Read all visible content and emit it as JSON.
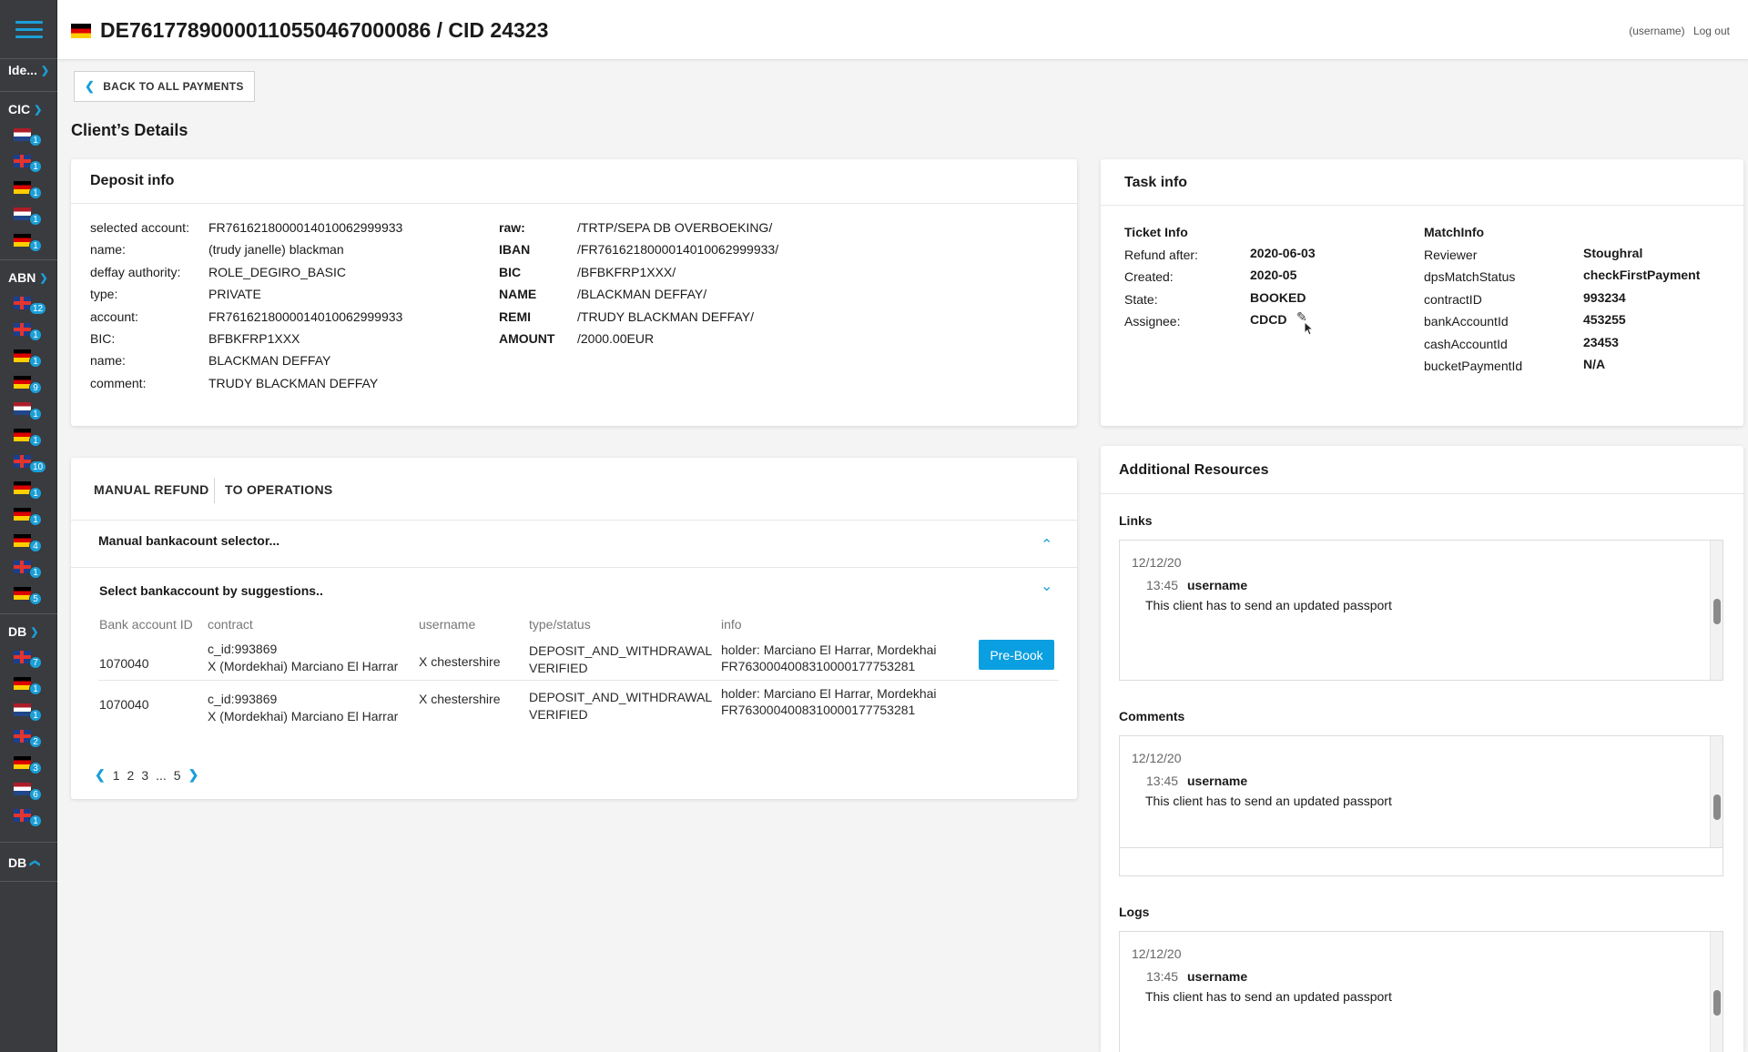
{
  "header": {
    "title": "DE76177890000110550467000086 / CID 24323",
    "username": "(username)",
    "logout_label": "Log out"
  },
  "sidebar": {
    "groups": [
      {
        "label": "Ide...",
        "items": []
      },
      {
        "label": "CIC",
        "items": [
          {
            "flag": "nl",
            "badge": "1"
          },
          {
            "flag": "uk",
            "badge": "1"
          },
          {
            "flag": "de",
            "badge": "1"
          },
          {
            "flag": "nl",
            "badge": "1"
          },
          {
            "flag": "de",
            "badge": "1"
          }
        ]
      },
      {
        "label": "ABN",
        "items": [
          {
            "flag": "uk",
            "badge": "12"
          },
          {
            "flag": "uk",
            "badge": "1"
          },
          {
            "flag": "de",
            "badge": "1"
          },
          {
            "flag": "de",
            "badge": "9"
          },
          {
            "flag": "nl",
            "badge": "1"
          },
          {
            "flag": "de",
            "badge": "1"
          },
          {
            "flag": "uk",
            "badge": "10"
          },
          {
            "flag": "de",
            "badge": "1"
          },
          {
            "flag": "de",
            "badge": "1"
          },
          {
            "flag": "de",
            "badge": "4"
          },
          {
            "flag": "uk",
            "badge": "1"
          },
          {
            "flag": "de",
            "badge": "5"
          }
        ]
      },
      {
        "label": "DB",
        "items": [
          {
            "flag": "uk",
            "badge": "7"
          },
          {
            "flag": "de",
            "badge": "1"
          },
          {
            "flag": "nl",
            "badge": "1"
          },
          {
            "flag": "uk",
            "badge": "2"
          },
          {
            "flag": "de",
            "badge": "3"
          },
          {
            "flag": "nl",
            "badge": "6"
          },
          {
            "flag": "uk",
            "badge": "1"
          }
        ]
      },
      {
        "label": "DB",
        "items": []
      }
    ]
  },
  "back_label": "BACK TO ALL PAYMENTS",
  "section_title": "Client’s Details",
  "deposit": {
    "title": "Deposit info",
    "left": [
      {
        "k": "selected account:",
        "v": "FR7616218000014010062999933"
      },
      {
        "k": "name:",
        "v": "(trudy janelle) blackman"
      },
      {
        "k": "deffay authority:",
        "v": "ROLE_DEGIRO_BASIC"
      },
      {
        "k": "type:",
        "v": "PRIVATE"
      },
      {
        "k": "account:",
        "v": "FR7616218000014010062999933"
      },
      {
        "k": "BIC:",
        "v": "BFBKFRP1XXX"
      },
      {
        "k": "name:",
        "v": "BLACKMAN DEFFAY"
      },
      {
        "k": "comment:",
        "v": "TRUDY BLACKMAN DEFFAY"
      }
    ],
    "right": [
      {
        "k": "raw:",
        "v": "/TRTP/SEPA DB OVERBOEKING/"
      },
      {
        "k": "IBAN",
        "v": "/FR7616218000014010062999933/"
      },
      {
        "k": "BIC",
        "v": "/BFBKFRP1XXX/"
      },
      {
        "k": "NAME",
        "v": "/BLACKMAN DEFFAY/"
      },
      {
        "k": "REMI",
        "v": "/TRUDY BLACKMAN DEFFAY/"
      },
      {
        "k": "AMOUNT",
        "v": "/2000.00EUR"
      }
    ]
  },
  "task": {
    "title": "Task info",
    "ticket_label": "Ticket Info",
    "ticket": [
      {
        "k": "Refund after:",
        "v": "2020-06-03"
      },
      {
        "k": "Created:",
        "v": "2020-05"
      },
      {
        "k": "State:",
        "v": "BOOKED"
      },
      {
        "k": "Assignee:",
        "v": "CDCD"
      }
    ],
    "match_label": "MatchInfo",
    "match": [
      {
        "k": "Reviewer",
        "v": "Stoughral"
      },
      {
        "k": "dpsMatchStatus",
        "v": "checkFirstPayment"
      },
      {
        "k": "contractID",
        "v": "993234"
      },
      {
        "k": "bankAccountId",
        "v": "453255"
      },
      {
        "k": "cashAccountId",
        "v": "23453"
      },
      {
        "k": "bucketPaymentId",
        "v": "N/A"
      }
    ]
  },
  "refund": {
    "tabs": [
      "MANUAL REFUND",
      "TO OPERATIONS"
    ],
    "manual_selector": "Manual bankacount selector...",
    "suggestions": "Select bankaccount by suggestions..",
    "columns": [
      "Bank account ID",
      "contract",
      "username",
      "type/status",
      "info"
    ],
    "rows": [
      {
        "id": "1070040",
        "contract_1": "c_id:993869",
        "contract_2": "X (Mordekhai) Marciano El Harrar",
        "username": "X chestershire",
        "type_1": "DEPOSIT_AND_WITHDRAWAL",
        "type_2": "VERIFIED",
        "info_1": "holder: Marciano El Harrar, Mordekhai",
        "info_2": "FR7630004008310000177753281"
      },
      {
        "id": "1070040",
        "contract_1": "c_id:993869",
        "contract_2": "X (Mordekhai) Marciano El Harrar",
        "username": "X chestershire",
        "type_1": "DEPOSIT_AND_WITHDRAWAL",
        "type_2": "VERIFIED",
        "info_1": "holder: Marciano El Harrar, Mordekhai",
        "info_2": "FR7630004008310000177753281"
      }
    ],
    "prebook_label": "Pre-Book",
    "pager": {
      "p1": "1",
      "p2": "2",
      "p3": "3",
      "ellipsis": "...",
      "last": "5"
    }
  },
  "resources": {
    "title": "Additional Resources",
    "links_label": "Links",
    "comments_label": "Comments",
    "logs_label": "Logs",
    "entry": {
      "date": "12/12/20",
      "time": "13:45",
      "user": "username",
      "text": "This client has to send an updated passport"
    }
  },
  "colors": {
    "accent": "#1a9fd8",
    "button": "#0a9fe0",
    "sidebar": "#3a3b3f"
  }
}
